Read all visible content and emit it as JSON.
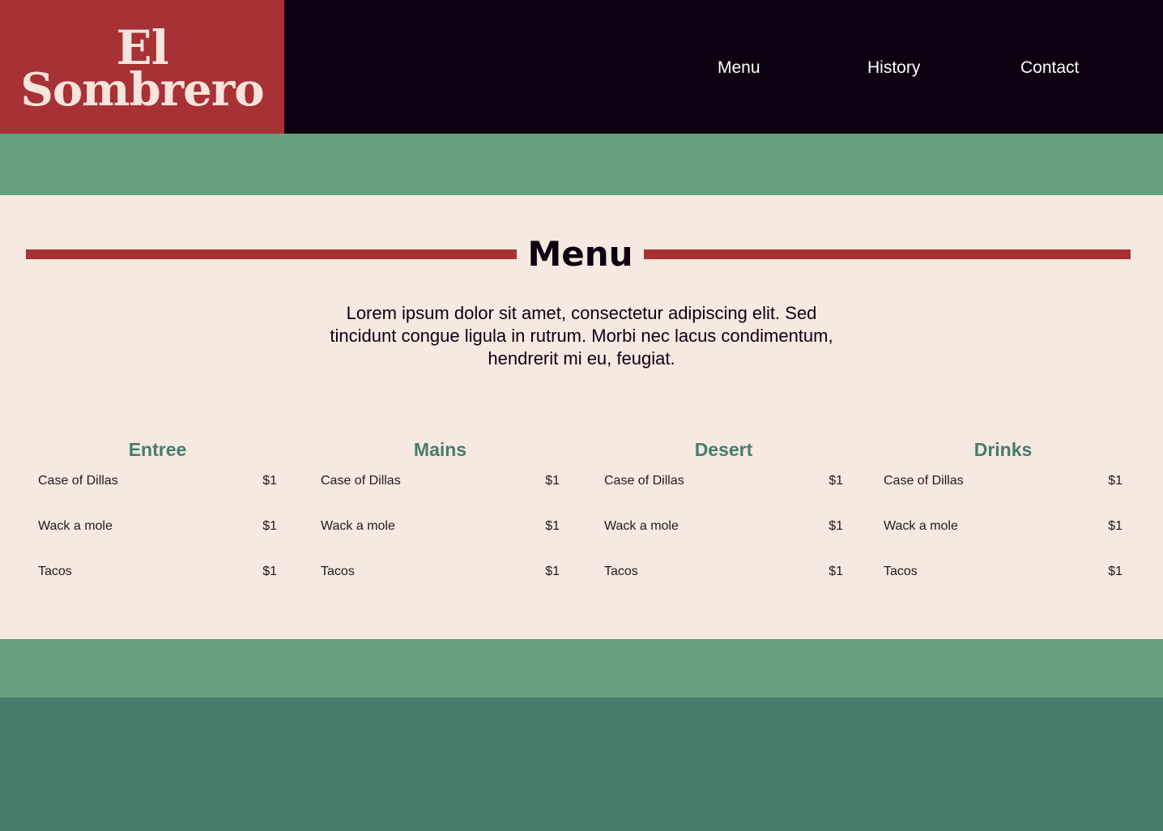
{
  "brand": {
    "line1": "El",
    "line2": "Sombrero"
  },
  "nav": {
    "items": [
      "Menu",
      "History",
      "Contact"
    ]
  },
  "menu_section": {
    "title": "Menu",
    "intro": "Lorem ipsum dolor sit amet, consectetur adipiscing elit. Sed tincidunt congue ligula in rutrum. Morbi nec lacus condimentum, hendrerit mi eu, feugiat.",
    "columns": [
      {
        "title": "Entree",
        "items": [
          {
            "name": "Case of Dillas",
            "price": "$1"
          },
          {
            "name": "Wack a mole",
            "price": "$1"
          },
          {
            "name": "Tacos",
            "price": "$1"
          }
        ]
      },
      {
        "title": "Mains",
        "items": [
          {
            "name": "Case of Dillas",
            "price": "$1"
          },
          {
            "name": "Wack a mole",
            "price": "$1"
          },
          {
            "name": "Tacos",
            "price": "$1"
          }
        ]
      },
      {
        "title": "Desert",
        "items": [
          {
            "name": "Case of Dillas",
            "price": "$1"
          },
          {
            "name": "Wack a mole",
            "price": "$1"
          },
          {
            "name": "Tacos",
            "price": "$1"
          }
        ]
      },
      {
        "title": "Drinks",
        "items": [
          {
            "name": "Case of Dillas",
            "price": "$1"
          },
          {
            "name": "Wack a mole",
            "price": "$1"
          },
          {
            "name": "Tacos",
            "price": "$1"
          }
        ]
      }
    ]
  },
  "colors": {
    "header_bg": "#0d0011",
    "brand_red": "#a83136",
    "brand_text": "#f8e4da",
    "band_green": "#67a180",
    "footer_green": "#457d6d",
    "page_bg": "#f6e9e1"
  }
}
